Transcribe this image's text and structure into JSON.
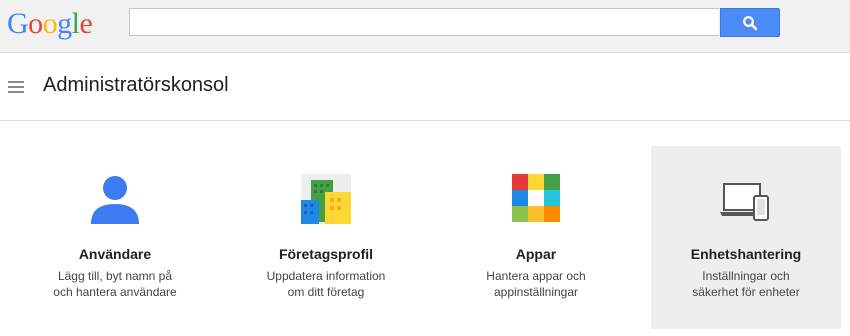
{
  "logo": {
    "letters": [
      "G",
      "o",
      "o",
      "g",
      "l",
      "e"
    ],
    "colors": [
      "#4285f4",
      "#ea4335",
      "#fbbc05",
      "#4285f4",
      "#34a853",
      "#ea4335"
    ]
  },
  "search": {
    "value": "",
    "placeholder": "",
    "button_icon": "search-icon"
  },
  "header": {
    "title": "Administratörskonsol",
    "menu_icon": "hamburger-menu-icon"
  },
  "tiles": [
    {
      "title": "Användare",
      "desc": [
        "Lägg till, byt namn på",
        "och hantera användare"
      ],
      "icon": "user-icon"
    },
    {
      "title": "Företagsprofil",
      "desc": [
        "Uppdatera information",
        "om ditt företag"
      ],
      "icon": "company-buildings-icon"
    },
    {
      "title": "Appar",
      "desc": [
        "Hantera appar och",
        "appinställningar"
      ],
      "icon": "apps-grid-icon"
    },
    {
      "title": "Enhetshantering",
      "desc": [
        "Inställningar och",
        "säkerhet för enheter"
      ],
      "icon": "devices-icon",
      "selected": true
    }
  ],
  "colors": {
    "accent": "#4c8bf5",
    "user_blue": "#3d7cf0",
    "selected_bg": "#eeeeee"
  }
}
